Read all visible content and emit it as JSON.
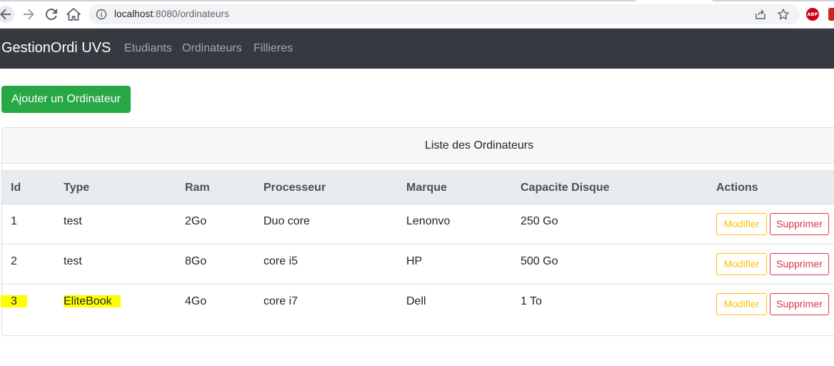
{
  "browser": {
    "url_host": "localhost",
    "url_path": ":8080/ordinateurs",
    "abp_label": "ABP"
  },
  "navbar": {
    "brand": "GestionOrdi UVS",
    "links": [
      "Etudiants",
      "Ordinateurs",
      "Fillieres"
    ]
  },
  "add_button": "Ajouter un Ordinateur",
  "card": {
    "title": "Liste des Ordinateurs"
  },
  "table": {
    "headers": [
      "Id",
      "Type",
      "Ram",
      "Processeur",
      "Marque",
      "Capacite Disque",
      "Actions"
    ],
    "rows": [
      {
        "id": "1",
        "type": "test",
        "ram": "2Go",
        "processeur": "Duo core",
        "marque": "Lenonvo",
        "capacite": "250 Go"
      },
      {
        "id": "2",
        "type": "test",
        "ram": "8Go",
        "processeur": "core i5",
        "marque": "HP",
        "capacite": "500 Go"
      },
      {
        "id": "3",
        "type": "EliteBook",
        "ram": "4Go",
        "processeur": "core i7",
        "marque": "Dell",
        "capacite": "1 To"
      }
    ],
    "actions": {
      "edit": "Modifier",
      "delete": "Supprimer"
    }
  },
  "colors": {
    "navbar_bg": "#343a40",
    "success": "#28a745",
    "warning": "#ffc107",
    "danger": "#dc3545",
    "highlight": "#ffff00"
  }
}
